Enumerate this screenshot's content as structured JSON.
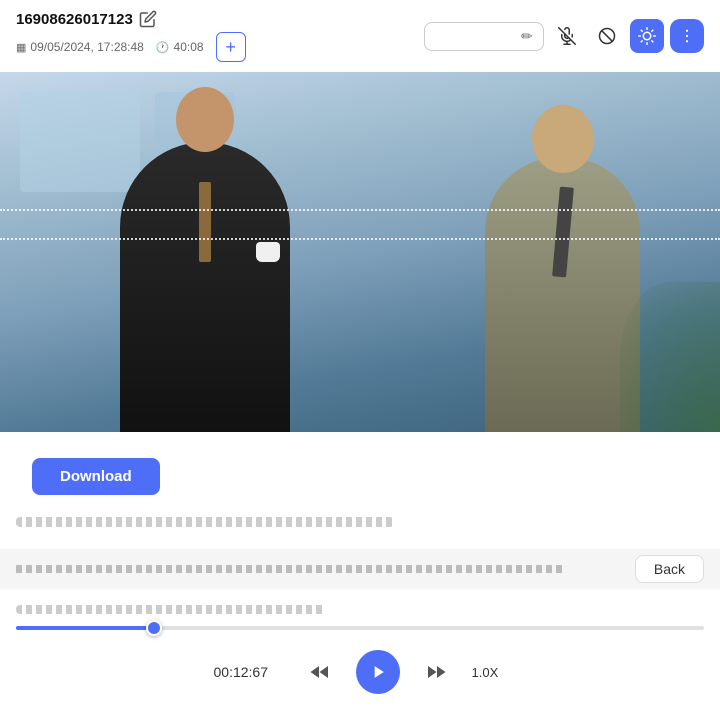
{
  "header": {
    "id": "16908626017123",
    "date": "09/05/2024, 17:28:48",
    "duration": "40:08",
    "add_label": "+",
    "search_placeholder": ""
  },
  "toolbar": {
    "pencil_icon": "✏",
    "hearing_off_icon": "hearing-off",
    "block_icon": "block",
    "brightness_icon": "brightness",
    "more_icon": "more"
  },
  "video": {
    "selection_line_1_top": "40%",
    "selection_line_2_top": "48%"
  },
  "download_button": {
    "label": "Download"
  },
  "info_bar": {
    "back_label": "Back"
  },
  "playback": {
    "time": "00:12:67",
    "speed": "1.0X",
    "progress_percent": 20
  }
}
